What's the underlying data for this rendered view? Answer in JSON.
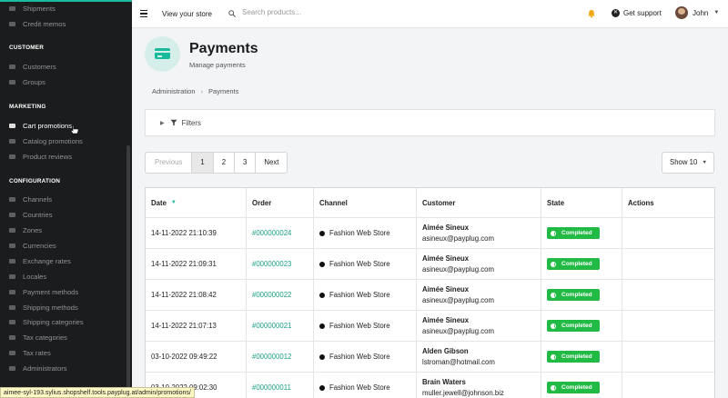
{
  "sidebar": {
    "items_top": [
      {
        "label": "Shipments",
        "icon": "truck-icon"
      },
      {
        "label": "Credit memos",
        "icon": "file-icon"
      }
    ],
    "sections": [
      {
        "title": "CUSTOMER",
        "items": [
          {
            "label": "Customers",
            "icon": "users-icon"
          },
          {
            "label": "Groups",
            "icon": "archive-icon"
          }
        ]
      },
      {
        "title": "MARKETING",
        "items": [
          {
            "label": "Cart promotions",
            "icon": "cart-icon",
            "active": true
          },
          {
            "label": "Catalog promotions",
            "icon": "tag-icon"
          },
          {
            "label": "Product reviews",
            "icon": "newspaper-icon"
          }
        ]
      },
      {
        "title": "CONFIGURATION",
        "items": [
          {
            "label": "Channels",
            "icon": "random-icon"
          },
          {
            "label": "Countries",
            "icon": "flag-icon"
          },
          {
            "label": "Zones",
            "icon": "globe-icon"
          },
          {
            "label": "Currencies",
            "icon": "dollar-icon"
          },
          {
            "label": "Exchange rates",
            "icon": "exchange-icon"
          },
          {
            "label": "Locales",
            "icon": "translate-icon"
          },
          {
            "label": "Payment methods",
            "icon": "payment-icon"
          },
          {
            "label": "Shipping methods",
            "icon": "shipping-icon"
          },
          {
            "label": "Shipping categories",
            "icon": "list-icon"
          },
          {
            "label": "Tax categories",
            "icon": "tags-icon"
          },
          {
            "label": "Tax rates",
            "icon": "money-icon"
          },
          {
            "label": "Administrators",
            "icon": "lock-icon"
          }
        ]
      }
    ]
  },
  "status_url": "aimee-syl-193.sylius.shopshelf.tools.payplug.at/admin/promotions/",
  "topbar": {
    "view_store": "View your store",
    "search_placeholder": "Search products...",
    "support": "Get support",
    "user": "John"
  },
  "header": {
    "title": "Payments",
    "subtitle": "Manage payments"
  },
  "breadcrumb": {
    "root": "Administration",
    "current": "Payments"
  },
  "filters_label": "Filters",
  "pagination": {
    "prev": "Previous",
    "pages": [
      "1",
      "2",
      "3"
    ],
    "current": "1",
    "next": "Next"
  },
  "show_label": "Show 10",
  "table": {
    "columns": [
      "Date",
      "Order",
      "Channel",
      "Customer",
      "State",
      "Actions"
    ],
    "rows": [
      {
        "date": "14-11-2022 21:10:39",
        "order": "#000000024",
        "channel": "Fashion Web Store",
        "name": "Aimée Sineux",
        "email": "asineux@payplug.com",
        "state": "Completed"
      },
      {
        "date": "14-11-2022 21:09:31",
        "order": "#000000023",
        "channel": "Fashion Web Store",
        "name": "Aimée Sineux",
        "email": "asineux@payplug.com",
        "state": "Completed"
      },
      {
        "date": "14-11-2022 21:08:42",
        "order": "#000000022",
        "channel": "Fashion Web Store",
        "name": "Aimée Sineux",
        "email": "asineux@payplug.com",
        "state": "Completed"
      },
      {
        "date": "14-11-2022 21:07:13",
        "order": "#000000021",
        "channel": "Fashion Web Store",
        "name": "Aimée Sineux",
        "email": "asineux@payplug.com",
        "state": "Completed"
      },
      {
        "date": "03-10-2022 09:49:22",
        "order": "#000000012",
        "channel": "Fashion Web Store",
        "name": "Alden Gibson",
        "email": "lstroman@hotmail.com",
        "state": "Completed"
      },
      {
        "date": "03-10-2022 09:02:30",
        "order": "#000000011",
        "channel": "Fashion Web Store",
        "name": "Brain Waters",
        "email": "muller.jewell@johnson.biz",
        "state": "Completed"
      }
    ]
  },
  "colors": {
    "accent": "#1abb9c",
    "completed": "#21ba45",
    "sidebar": "#1b1c1d"
  }
}
